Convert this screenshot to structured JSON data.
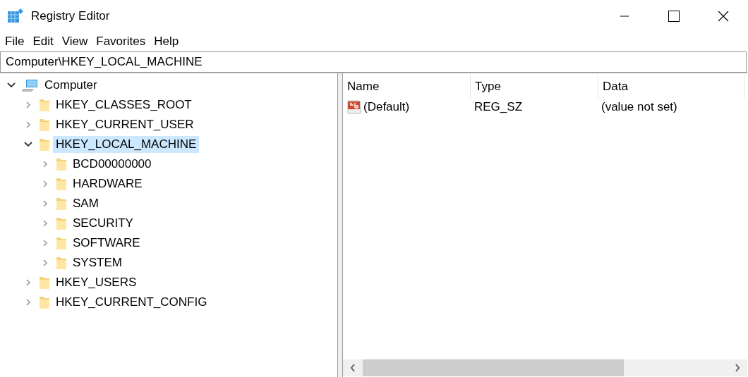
{
  "window": {
    "title": "Registry Editor"
  },
  "menu": [
    "File",
    "Edit",
    "View",
    "Favorites",
    "Help"
  ],
  "address": {
    "value": "Computer\\HKEY_LOCAL_MACHINE"
  },
  "tree": [
    {
      "label": "Computer",
      "kind": "computer",
      "expanded": true,
      "selected": false,
      "children": [
        {
          "label": "HKEY_CLASSES_ROOT",
          "kind": "folder",
          "expanded": false,
          "selected": false
        },
        {
          "label": "HKEY_CURRENT_USER",
          "kind": "folder",
          "expanded": false,
          "selected": false
        },
        {
          "label": "HKEY_LOCAL_MACHINE",
          "kind": "folder",
          "expanded": true,
          "selected": true,
          "children": [
            {
              "label": "BCD00000000",
              "kind": "folder",
              "expanded": false,
              "selected": false
            },
            {
              "label": "HARDWARE",
              "kind": "folder",
              "expanded": false,
              "selected": false
            },
            {
              "label": "SAM",
              "kind": "folder",
              "expanded": false,
              "selected": false
            },
            {
              "label": "SECURITY",
              "kind": "folder",
              "expanded": false,
              "selected": false
            },
            {
              "label": "SOFTWARE",
              "kind": "folder",
              "expanded": false,
              "selected": false
            },
            {
              "label": "SYSTEM",
              "kind": "folder",
              "expanded": false,
              "selected": false
            }
          ]
        },
        {
          "label": "HKEY_USERS",
          "kind": "folder",
          "expanded": false,
          "selected": false
        },
        {
          "label": "HKEY_CURRENT_CONFIG",
          "kind": "folder",
          "expanded": false,
          "selected": false
        }
      ]
    }
  ],
  "table": {
    "columns": [
      "Name",
      "Type",
      "Data"
    ],
    "rows": [
      {
        "kind": "string",
        "cells": [
          "(Default)",
          "REG_SZ",
          "(value not set)"
        ]
      }
    ]
  }
}
